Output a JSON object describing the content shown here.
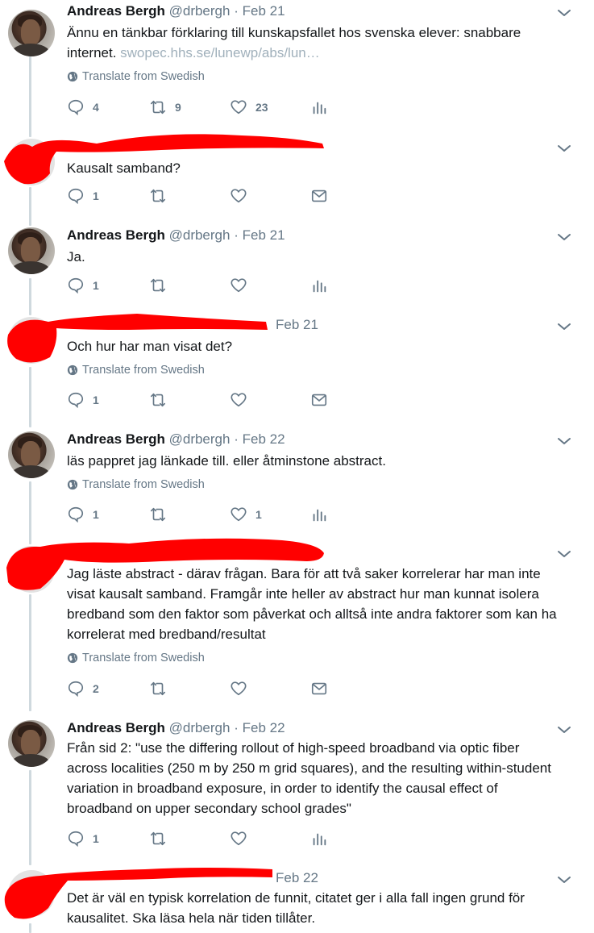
{
  "tweets": [
    {
      "name": "Andreas Bergh",
      "handle": "@drbergh",
      "date": "Feb 21",
      "text": "Ännu en tänkbar förklaring till kunskapsfallet hos svenska elever: snabbare",
      "text2": "internet. ",
      "link": "swopec.hhs.se/lunewp/abs/lun…",
      "translate": "Translate from Swedish",
      "replies": "4",
      "retweets": "9",
      "likes": "23"
    },
    {
      "name": "",
      "handle": "",
      "date": "",
      "text": "Kausalt samband?",
      "replies": "1",
      "retweets": "",
      "likes": ""
    },
    {
      "name": "Andreas Bergh",
      "handle": "@drbergh",
      "date": "Feb 21",
      "text": "Ja.",
      "replies": "1",
      "retweets": "",
      "likes": ""
    },
    {
      "name": "",
      "handle": "",
      "date": "Feb 21",
      "text": "Och hur har man visat det?",
      "translate": "Translate from Swedish",
      "replies": "1",
      "retweets": "",
      "likes": ""
    },
    {
      "name": "Andreas Bergh",
      "handle": "@drbergh",
      "date": "Feb 22",
      "text": "läs pappret jag länkade till. eller åtminstone abstract.",
      "translate": "Translate from Swedish",
      "replies": "1",
      "retweets": "",
      "likes": "1"
    },
    {
      "name": "",
      "handle": "",
      "date": "",
      "lines": [
        "Jag läste abstract - därav frågan. Bara för att två saker korrelerar har man inte",
        "visat kausalt samband. Framgår inte heller av abstract hur man kunnat isolera",
        "bredband som den faktor som påverkat och alltså inte andra faktorer som kan ha",
        "korrelerat med bredband/resultat"
      ],
      "translate": "Translate from Swedish",
      "replies": "2",
      "retweets": "",
      "likes": ""
    },
    {
      "name": "Andreas Bergh",
      "handle": "@drbergh",
      "date": "Feb 22",
      "lines": [
        "Från sid 2: \"use the differing rollout of high-speed broadband via optic fiber",
        "across localities (250 m by 250 m grid squares), and the resulting within-student",
        "variation in broadband exposure, in order to identify the causal effect of",
        "broadband on upper secondary school grades\""
      ],
      "replies": "1",
      "retweets": "",
      "likes": ""
    },
    {
      "name": "",
      "handle": "",
      "date": "Feb 22",
      "lines": [
        "Det är väl en typisk korrelation de funnit, citatet ger i alla fall ingen grund för",
        "kausalitet. Ska läsa hela när tiden tillåter."
      ]
    }
  ],
  "colors": {
    "text": "#14171a",
    "muted": "#657786",
    "link": "#a0b0bb",
    "thread": "#cfd9de",
    "redaction": "#ff0000"
  }
}
